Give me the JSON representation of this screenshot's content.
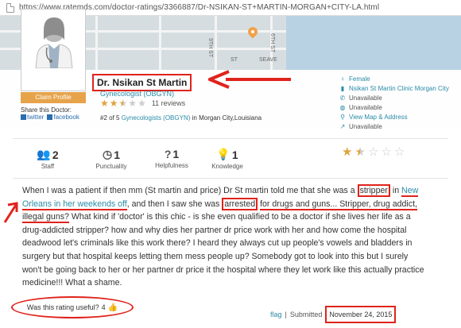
{
  "browser": {
    "url": "https://www.ratemds.com/doctor-ratings/3366887/Dr-NSIKAN-ST+MARTIN-MORGAN+CITY-LA.html"
  },
  "map": {
    "streets": [
      "9TH ST",
      "SEAVE",
      "ST",
      "6TH ST"
    ]
  },
  "profile": {
    "claim_label": "Claim Profile",
    "share_label": "Share this Doctor:",
    "twitter_label": "twitter",
    "facebook_label": "facebook"
  },
  "doctor": {
    "name": "Dr. Nsikan St Martin",
    "specialty": "Gynecologist (OBGYN)",
    "rating": 2.5,
    "reviews": "11 reviews",
    "rank_prefix": "#2 of 5",
    "rank_link": "Gynecologists (OBGYN)",
    "rank_suffix": "in Morgan City,Louisiana"
  },
  "info": {
    "gender": "Female",
    "clinic": "Nsikan St Martin Clinic Morgan City",
    "phone": "Unavailable",
    "website": "Unavailable",
    "map_link": "View Map & Address",
    "edit": "Unavailable"
  },
  "stats": {
    "staff_value": "2",
    "staff_label": "Staff",
    "punctuality_value": "1",
    "punctuality_label": "Punctuality",
    "helpfulness_value": "1",
    "helpfulness_label": "Helpfulness",
    "knowledge_value": "1",
    "knowledge_label": "Knowledge",
    "overall_rating": 1.5
  },
  "review": {
    "p1": "When I was a patient if then mm (St martin and price) Dr St martin told me that she was a ",
    "stripper": "stripper",
    "p2": " in ",
    "new_orleans": "New Orleans in her weekends off",
    "p3": ", and then I saw she was ",
    "arrested": "arrested",
    "p4": " ",
    "for_drugs": "for drugs and guns... Stripper, drug addict, illegal guns?",
    "p5": " What kind if 'doctor' is this chic - is she even qualified to be a doctor if she lives her life as a drug-addicted stripper? how and why dies her partner dr price work with her and how come the hospital deadwood let's criminals like this work there? I heard they always cut up people's vowels and bladders in surgery but that hospital keeps letting them mess people up? Somebody got to look into this but I surely won't be going back to her or her partner dr price it the hospital where they let work like this actually practice medicine!!! What a shame."
  },
  "footer": {
    "useful_label": "Was this rating useful?",
    "useful_count": "4",
    "flag": "flag",
    "separator": "|",
    "submitted_label": "Submitted",
    "date": "November 24, 2015"
  }
}
